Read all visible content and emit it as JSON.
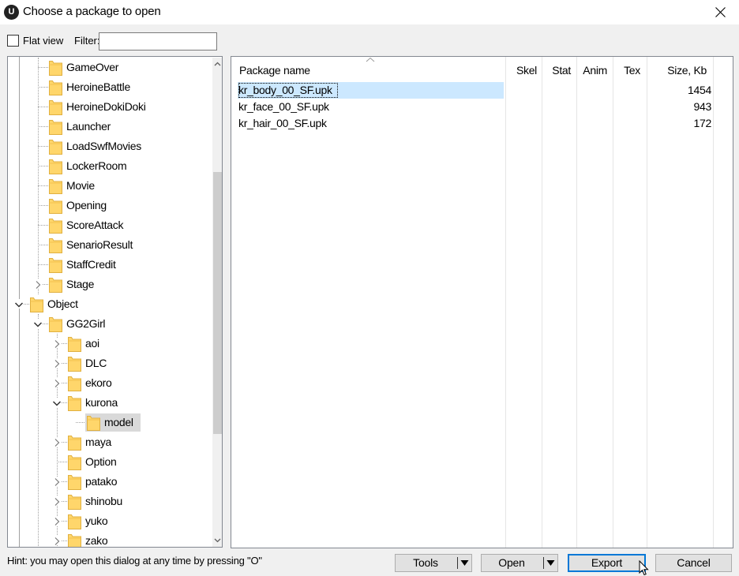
{
  "window": {
    "title": "Choose a package to open",
    "app_icon_label": "U"
  },
  "toolbar": {
    "flat_view_label": "Flat view",
    "flat_view_checked": false,
    "filter_label": "Filter:",
    "filter_value": ""
  },
  "tree": {
    "items": [
      {
        "label": "GameOver",
        "depth": 2,
        "expander": "none"
      },
      {
        "label": "HeroineBattle",
        "depth": 2,
        "expander": "none"
      },
      {
        "label": "HeroineDokiDoki",
        "depth": 2,
        "expander": "none"
      },
      {
        "label": "Launcher",
        "depth": 2,
        "expander": "none"
      },
      {
        "label": "LoadSwfMovies",
        "depth": 2,
        "expander": "none"
      },
      {
        "label": "LockerRoom",
        "depth": 2,
        "expander": "none"
      },
      {
        "label": "Movie",
        "depth": 2,
        "expander": "none"
      },
      {
        "label": "Opening",
        "depth": 2,
        "expander": "none"
      },
      {
        "label": "ScoreAttack",
        "depth": 2,
        "expander": "none"
      },
      {
        "label": "SenarioResult",
        "depth": 2,
        "expander": "none"
      },
      {
        "label": "StaffCredit",
        "depth": 2,
        "expander": "none"
      },
      {
        "label": "Stage",
        "depth": 2,
        "expander": "collapsed"
      },
      {
        "label": "Object",
        "depth": 1,
        "expander": "expanded"
      },
      {
        "label": "GG2Girl",
        "depth": 2,
        "expander": "expanded"
      },
      {
        "label": "aoi",
        "depth": 3,
        "expander": "collapsed"
      },
      {
        "label": "DLC",
        "depth": 3,
        "expander": "collapsed"
      },
      {
        "label": "ekoro",
        "depth": 3,
        "expander": "collapsed"
      },
      {
        "label": "kurona",
        "depth": 3,
        "expander": "expanded"
      },
      {
        "label": "model",
        "depth": 4,
        "expander": "none",
        "selected": true
      },
      {
        "label": "maya",
        "depth": 3,
        "expander": "collapsed"
      },
      {
        "label": "Option",
        "depth": 3,
        "expander": "none"
      },
      {
        "label": "patako",
        "depth": 3,
        "expander": "collapsed"
      },
      {
        "label": "shinobu",
        "depth": 3,
        "expander": "collapsed"
      },
      {
        "label": "yuko",
        "depth": 3,
        "expander": "collapsed"
      },
      {
        "label": "zako",
        "depth": 3,
        "expander": "collapsed"
      }
    ]
  },
  "list": {
    "columns": [
      "Package name",
      "Skel",
      "Stat",
      "Anim",
      "Tex",
      "Size, Kb"
    ],
    "sort_column": "Package name",
    "rows": [
      {
        "name": "kr_body_00_SF.upk",
        "size": "1454",
        "selected": true
      },
      {
        "name": "kr_face_00_SF.upk",
        "size": "943",
        "selected": false
      },
      {
        "name": "kr_hair_00_SF.upk",
        "size": "172",
        "selected": false
      }
    ]
  },
  "footer": {
    "hint": "Hint: you may open this dialog at any time by pressing \"O\"",
    "tools_label": "Tools",
    "open_label": "Open",
    "export_label": "Export",
    "cancel_label": "Cancel"
  },
  "colors": {
    "selection": "#cce8ff",
    "tree_selection": "#d9d9d9",
    "default_button_border": "#0078d7",
    "folder": "#ffd66b"
  }
}
